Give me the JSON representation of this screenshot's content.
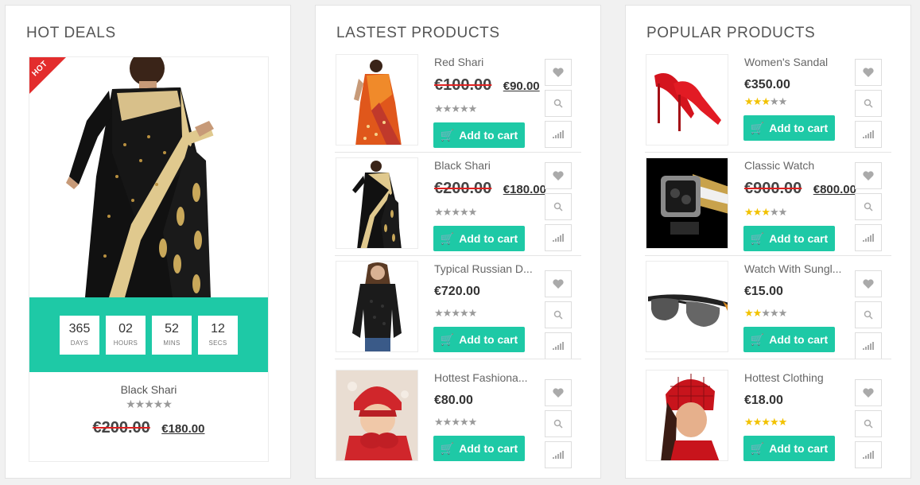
{
  "hot_deals": {
    "title": "HOT DEALS",
    "ribbon": "HOT",
    "countdown": [
      {
        "value": "365",
        "label": "DAYS"
      },
      {
        "value": "02",
        "label": "HOURS"
      },
      {
        "value": "52",
        "label": "MINS"
      },
      {
        "value": "12",
        "label": "SECS"
      }
    ],
    "product": {
      "name": "Black Shari",
      "old_price": "€200.00",
      "price": "€180.00",
      "rating": 0
    }
  },
  "latest": {
    "title": "LASTEST PRODUCTS",
    "products": [
      {
        "name": "Red Shari",
        "old_price": "€100.00",
        "price": "€90.00",
        "rating": 0,
        "image": "red-saree"
      },
      {
        "name": "Black Shari",
        "old_price": "€200.00",
        "price": "€180.00",
        "rating": 0,
        "image": "black-saree"
      },
      {
        "name": "Typical Russian D...",
        "price": "€720.00",
        "rating": 0,
        "image": "black-blouse"
      },
      {
        "name": "Hottest Fashiona...",
        "price": "€80.00",
        "rating": 0,
        "image": "red-winter-hat"
      }
    ]
  },
  "popular": {
    "title": "POPULAR PRODUCTS",
    "products": [
      {
        "name": "Women's Sandal",
        "price": "€350.00",
        "rating": 3,
        "image": "red-heels"
      },
      {
        "name": "Classic Watch",
        "old_price": "€900.00",
        "price": "€800.00",
        "rating": 3,
        "image": "watch"
      },
      {
        "name": "Watch With Sungl...",
        "price": "€15.00",
        "rating": 2,
        "image": "sunglasses"
      },
      {
        "name": "Hottest Clothing",
        "price": "€18.00",
        "rating": 5,
        "image": "red-headscarf"
      }
    ]
  },
  "labels": {
    "add_to_cart": "Add to cart"
  },
  "colors": {
    "accent": "#1ec9a6",
    "hot": "#e32d2d",
    "star_on": "#f2c200",
    "star_off": "#9a9a9a"
  }
}
